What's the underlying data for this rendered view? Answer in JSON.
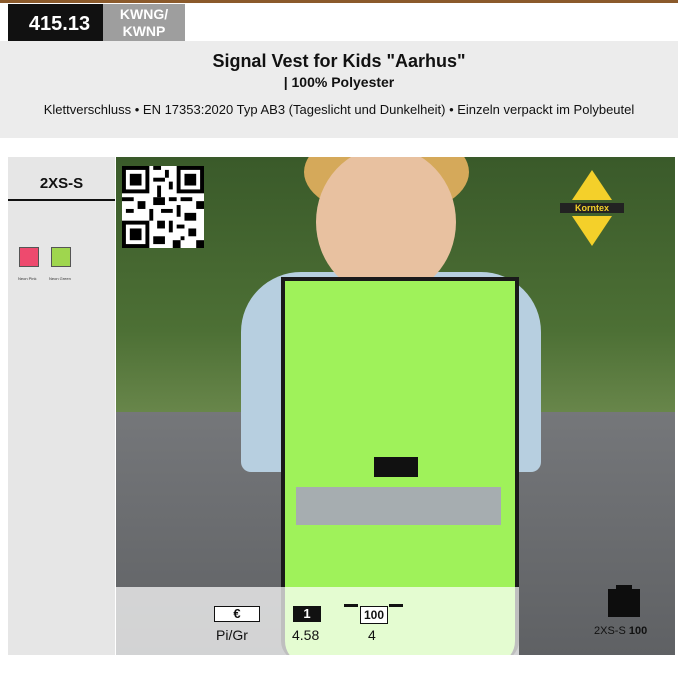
{
  "header": {
    "code": "415.13",
    "sku": [
      "KWNG/",
      "KWNP"
    ],
    "title": "Signal Vest for Kids \"Aarhus\"",
    "subtitle": "| 100% Polyester",
    "description": "Klettverschluss • EN 17353:2020 Typ AB3 (Tageslicht und Dunkelheit) • Einzeln verpackt im Polybeutel"
  },
  "sidebar": {
    "size": "2XS-S",
    "swatches": [
      {
        "label": "Neon Pink",
        "color": "#ee4a6e"
      },
      {
        "label": "Neon Green",
        "color": "#9fd64e"
      }
    ]
  },
  "logo": {
    "text": "Korntex"
  },
  "pricing": {
    "currency": "€",
    "qty_1": "1",
    "qty_100": "100",
    "unit": "Pi/Gr",
    "price_1": "4.58",
    "price_100": "4"
  },
  "packaging": {
    "size": "2XS-S",
    "count": "100"
  },
  "colors": {
    "code_bg": "#111111",
    "sku_bg": "#9e9e9e",
    "header_bg": "#ececec",
    "vest": "#9ff25a"
  }
}
